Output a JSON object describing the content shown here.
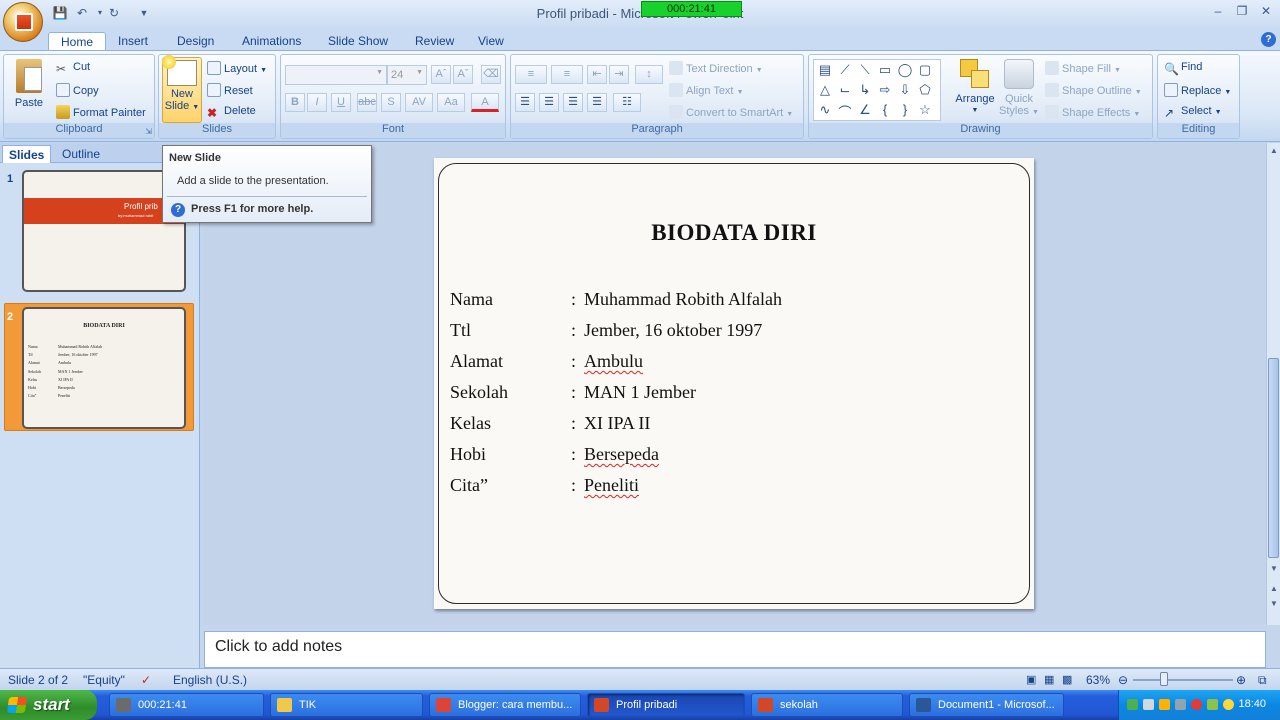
{
  "window": {
    "title": "Profil pribadi - Microsoft PowerPoint",
    "recording_timer": "000:21:41"
  },
  "ribbon_tabs": [
    "Home",
    "Insert",
    "Design",
    "Animations",
    "Slide Show",
    "Review",
    "View"
  ],
  "clipboard": {
    "paste": "Paste",
    "cut": "Cut",
    "copy": "Copy",
    "format_painter": "Format Painter",
    "label": "Clipboard"
  },
  "slides_group": {
    "new_slide_line1": "New",
    "new_slide_line2": "Slide",
    "layout": "Layout",
    "reset": "Reset",
    "delete": "Delete",
    "label": "Slides"
  },
  "font": {
    "size": "24",
    "label": "Font"
  },
  "paragraph": {
    "text_direction": "Text Direction",
    "align_text": "Align Text",
    "convert_smartart": "Convert to SmartArt",
    "label": "Paragraph"
  },
  "drawing": {
    "arrange": "Arrange",
    "quick_styles_1": "Quick",
    "quick_styles_2": "Styles",
    "shape_fill": "Shape Fill",
    "shape_outline": "Shape Outline",
    "shape_effects": "Shape Effects",
    "label": "Drawing"
  },
  "editing": {
    "find": "Find",
    "replace": "Replace",
    "select": "Select",
    "label": "Editing"
  },
  "pane_tabs": {
    "slides": "Slides",
    "outline": "Outline"
  },
  "thumbnails": [
    {
      "number": "1",
      "title": "Profil prib",
      "subtitle": "by:muhammad robit"
    },
    {
      "number": "2",
      "title": "BIODATA DIRI"
    }
  ],
  "tooltip": {
    "title": "New Slide",
    "description": "Add a slide to the presentation.",
    "help": "Press F1 for more help."
  },
  "slide": {
    "title": "BIODATA  DIRI",
    "rows": [
      {
        "label": "Nama",
        "value": "Muhammad  Robith Alfalah"
      },
      {
        "label": "Ttl",
        "value": "Jember, 16 oktober 1997"
      },
      {
        "label": "Alamat",
        "value": "Ambulu"
      },
      {
        "label": "Sekolah",
        "value": "MAN 1 Jember"
      },
      {
        "label": "Kelas",
        "value": "XI IPA II"
      },
      {
        "label": "Hobi",
        "value": "Bersepeda"
      },
      {
        "label": "Cita”",
        "value": "Peneliti"
      }
    ],
    "colon": ":"
  },
  "notes_placeholder": "Click to add notes",
  "statusbar": {
    "slide_info": "Slide 2 of 2",
    "theme": "\"Equity\"",
    "language": "English (U.S.)",
    "zoom": "63%"
  },
  "taskbar": {
    "start": "start",
    "items": [
      {
        "label": "000:21:41",
        "color": "#6b6b6b"
      },
      {
        "label": "TIK",
        "color": "#f2c84b"
      },
      {
        "label": "Blogger: cara membu...",
        "color": "#db4437"
      },
      {
        "label": "Profil pribadi",
        "color": "#d24726"
      },
      {
        "label": "sekolah",
        "color": "#d24726"
      },
      {
        "label": "Document1 - Microsof...",
        "color": "#2b5797"
      }
    ],
    "clock": "18:40"
  },
  "colors": {
    "accent": "#15428b",
    "thumb1_band": "#d5411d",
    "selected_thumb": "#f29a3a"
  }
}
